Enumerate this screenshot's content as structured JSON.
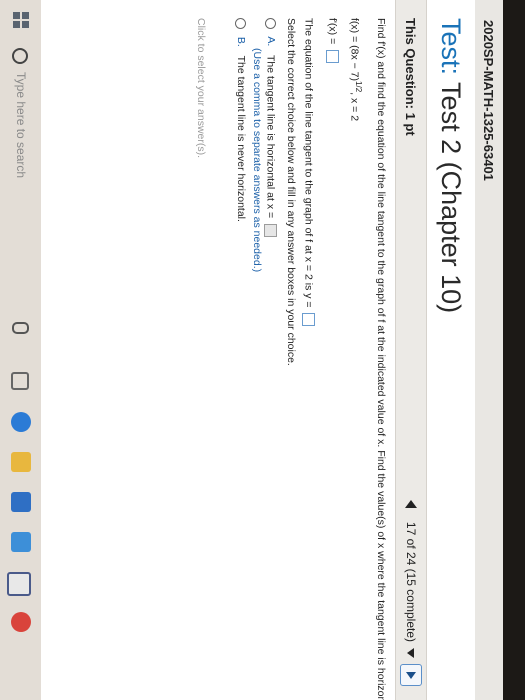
{
  "browser": {
    "course_title": "2020SP-MATH-1325-63401"
  },
  "test": {
    "label": "Test:",
    "title": "Test 2 (Chapter 10)"
  },
  "question_bar": {
    "points_label": "This Question: 1 pt",
    "progress": "17 of 24 (15 complete)"
  },
  "question": {
    "prompt": "Find f'(x) and find the equation of the line tangent to the graph of f at the indicated value of x. Find the value(s) of x where the tangent line is horizontal.",
    "function": "f(x) = (8x − 7)",
    "exponent": "1/2",
    "x_value": ",   x = 2",
    "derivative_label": "f'(x) =",
    "tangent_line_text": "The equation of the line tangent to the graph of f at x = 2 is y =",
    "select_instruction": "Select the correct choice below and fill in any answer boxes in your choice.",
    "options": [
      {
        "letter": "A.",
        "text": "The tangent line is horizontal at x =",
        "hint": "(Use a comma to separate answers as needed.)"
      },
      {
        "letter": "B.",
        "text": "The tangent line is never horizontal."
      }
    ],
    "click_note": "Click to select your answer(s)."
  },
  "taskbar": {
    "search_placeholder": "Type here to search"
  },
  "colors": {
    "accent": "#1a73b8",
    "link": "#1a5fa8"
  },
  "icons": [
    "windows-icon",
    "search-icon",
    "microphone-icon",
    "task-view-icon",
    "edge-icon",
    "file-explorer-icon",
    "store-icon",
    "mail-icon",
    "chrome-icon"
  ]
}
